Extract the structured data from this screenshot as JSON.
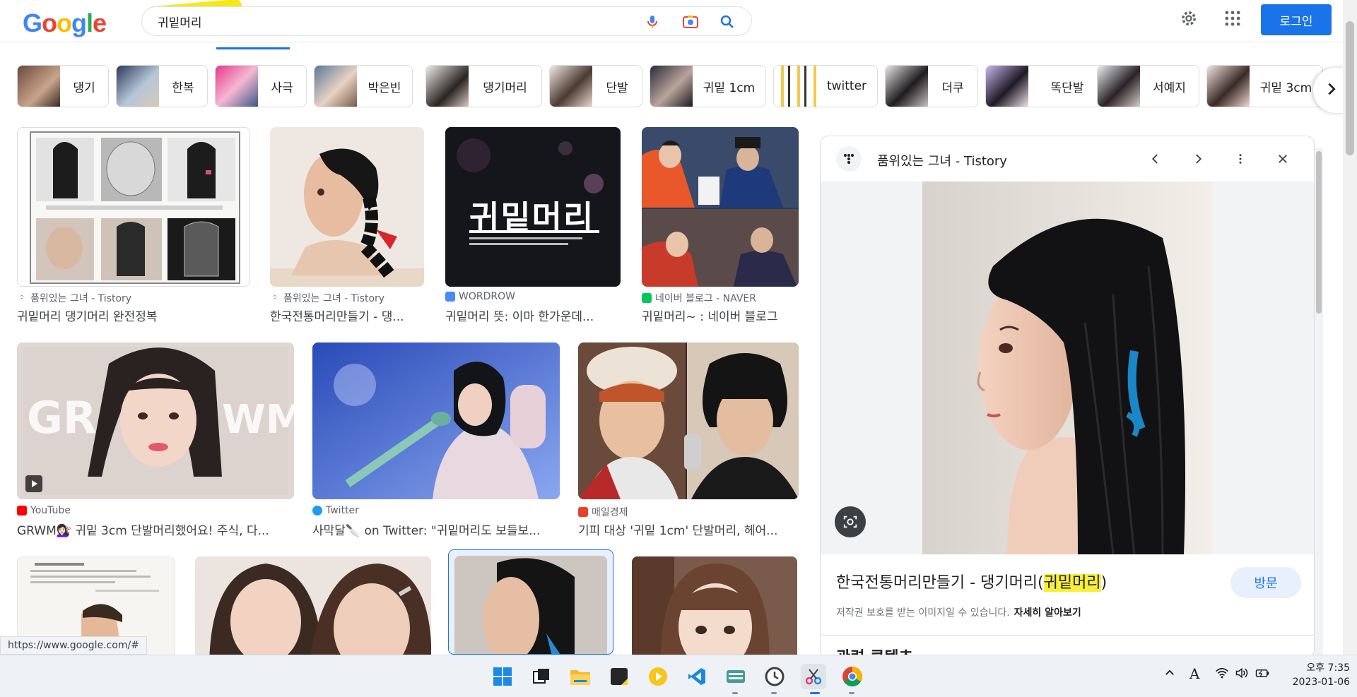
{
  "header": {
    "logo_letters": [
      "G",
      "o",
      "o",
      "g",
      "l",
      "e"
    ],
    "search_query": "귀밑머리",
    "login_label": "로그인"
  },
  "icons": {
    "mic": "mic-icon",
    "lens": "camera-lens-icon",
    "search": "search-icon",
    "settings": "gear-icon",
    "apps": "apps-grid-icon"
  },
  "chips": [
    {
      "label": "댕기"
    },
    {
      "label": "한복"
    },
    {
      "label": "사극"
    },
    {
      "label": "박은빈"
    },
    {
      "label": "댕기머리"
    },
    {
      "label": "단발"
    },
    {
      "label": "귀밑 1cm"
    },
    {
      "label": "twitter"
    },
    {
      "label": "더쿠"
    },
    {
      "label": "똑단발"
    },
    {
      "label": "서예지"
    },
    {
      "label": "귀밑 3cm"
    }
  ],
  "results": [
    {
      "source": "품위있는 그녀 - Tistory",
      "title": "귀밑머리 댕기머리 완전정복"
    },
    {
      "source": "품위있는 그녀 - Tistory",
      "title": "한국전통머리만들기 - 댕..."
    },
    {
      "source": "WORDROW",
      "title": "귀밑머리 뜻: 이마 한가운데..."
    },
    {
      "source": "네이버 블로그 - NAVER",
      "title": "귀밑머리~ : 네이버 블로그"
    },
    {
      "source": "YouTube",
      "title": "GRWM💇🏻‍♀️ 귀밑 3cm 단발머리했어요! 주식, 다..."
    },
    {
      "source": "Twitter",
      "title": "사막달🔪 on Twitter: \"귀밑머리도 보들보..."
    },
    {
      "source": "매일경제",
      "title": "기피 대상 '귀밑 1cm' 단발머리, 헤어..."
    },
    {
      "source": "",
      "title": ""
    },
    {
      "source": "",
      "title": ""
    },
    {
      "source": "",
      "title": ""
    },
    {
      "source": "",
      "title": ""
    }
  ],
  "image_texts": {
    "wordrow_big": "귀밑머리"
  },
  "panel": {
    "source_name": "품위있는 그녀 - Tistory",
    "title_before": "한국전통머리만들기 - 댕기머리(",
    "title_highlight": "귀밑머리",
    "title_after": ")",
    "visit_label": "방문",
    "copyright_text": "저작권 보호를 받는 이미지일 수 있습니다.",
    "learn_more": "자세히 알아보기",
    "related_heading": "관련 콘텐츠"
  },
  "status_url": "https://www.google.com/#",
  "taskbar": {
    "tray_ime": "A",
    "time": "오후 7:35",
    "date": "2023-01-06"
  },
  "colors": {
    "accent_blue": "#1a73e8",
    "highlight_yellow": "#f9ef3a"
  }
}
